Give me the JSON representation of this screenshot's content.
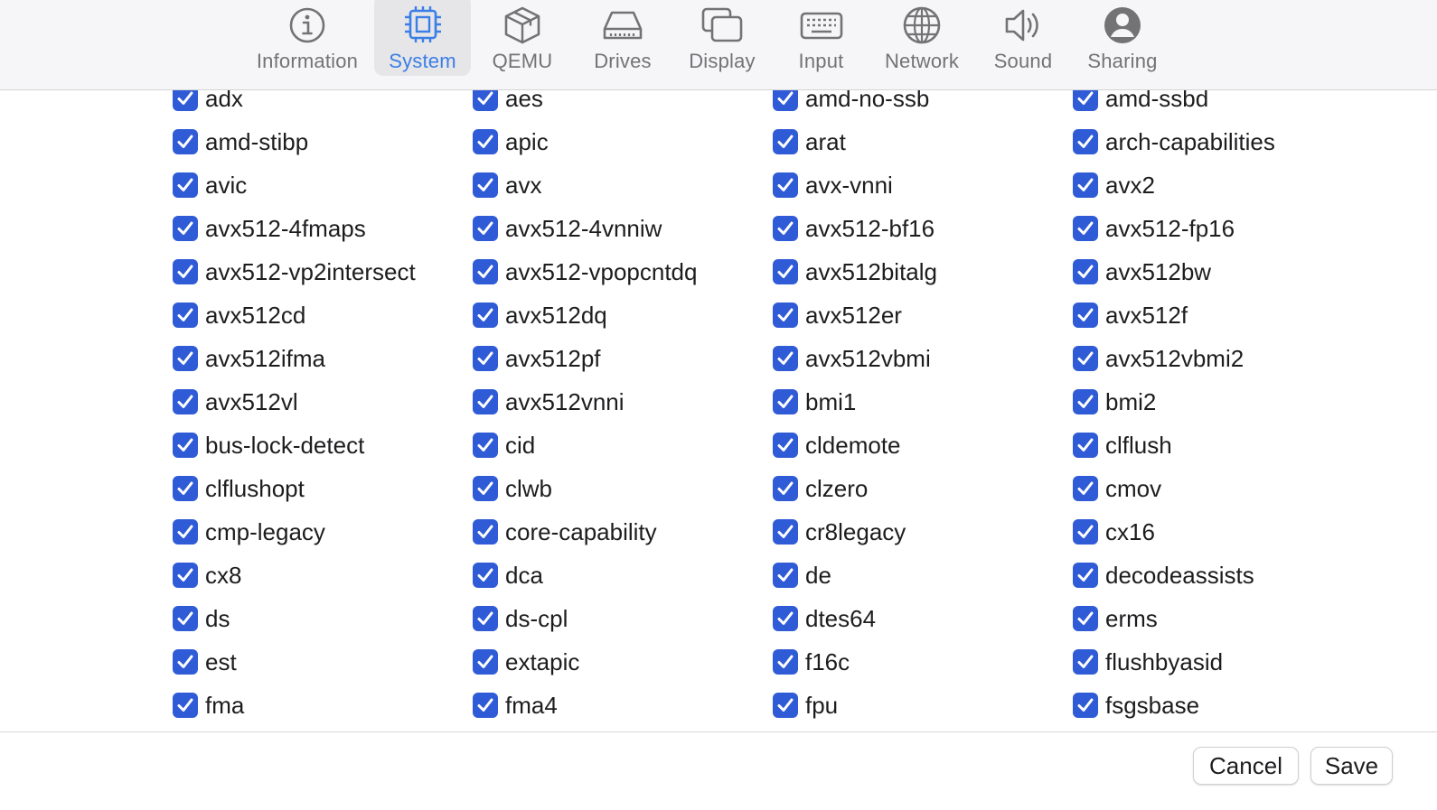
{
  "toolbar": {
    "tabs": [
      {
        "label": "Information",
        "icon": "info-icon",
        "active": false
      },
      {
        "label": "System",
        "icon": "cpu-icon",
        "active": true
      },
      {
        "label": "QEMU",
        "icon": "box-icon",
        "active": false
      },
      {
        "label": "Drives",
        "icon": "drive-icon",
        "active": false
      },
      {
        "label": "Display",
        "icon": "display-icon",
        "active": false
      },
      {
        "label": "Input",
        "icon": "keyboard-icon",
        "active": false
      },
      {
        "label": "Network",
        "icon": "globe-icon",
        "active": false
      },
      {
        "label": "Sound",
        "icon": "speaker-icon",
        "active": false
      },
      {
        "label": "Sharing",
        "icon": "person-icon",
        "active": false
      }
    ],
    "accent_color": "#3a7ee6"
  },
  "features": {
    "checked_color": "#2f5bd6",
    "items": [
      {
        "label": "adx",
        "checked": true
      },
      {
        "label": "aes",
        "checked": true
      },
      {
        "label": "amd-no-ssb",
        "checked": true
      },
      {
        "label": "amd-ssbd",
        "checked": true
      },
      {
        "label": "amd-stibp",
        "checked": true
      },
      {
        "label": "apic",
        "checked": true
      },
      {
        "label": "arat",
        "checked": true
      },
      {
        "label": "arch-capabilities",
        "checked": true
      },
      {
        "label": "avic",
        "checked": true
      },
      {
        "label": "avx",
        "checked": true
      },
      {
        "label": "avx-vnni",
        "checked": true
      },
      {
        "label": "avx2",
        "checked": true
      },
      {
        "label": "avx512-4fmaps",
        "checked": true
      },
      {
        "label": "avx512-4vnniw",
        "checked": true
      },
      {
        "label": "avx512-bf16",
        "checked": true
      },
      {
        "label": "avx512-fp16",
        "checked": true
      },
      {
        "label": "avx512-vp2intersect",
        "checked": true
      },
      {
        "label": "avx512-vpopcntdq",
        "checked": true
      },
      {
        "label": "avx512bitalg",
        "checked": true
      },
      {
        "label": "avx512bw",
        "checked": true
      },
      {
        "label": "avx512cd",
        "checked": true
      },
      {
        "label": "avx512dq",
        "checked": true
      },
      {
        "label": "avx512er",
        "checked": true
      },
      {
        "label": "avx512f",
        "checked": true
      },
      {
        "label": "avx512ifma",
        "checked": true
      },
      {
        "label": "avx512pf",
        "checked": true
      },
      {
        "label": "avx512vbmi",
        "checked": true
      },
      {
        "label": "avx512vbmi2",
        "checked": true
      },
      {
        "label": "avx512vl",
        "checked": true
      },
      {
        "label": "avx512vnni",
        "checked": true
      },
      {
        "label": "bmi1",
        "checked": true
      },
      {
        "label": "bmi2",
        "checked": true
      },
      {
        "label": "bus-lock-detect",
        "checked": true
      },
      {
        "label": "cid",
        "checked": true
      },
      {
        "label": "cldemote",
        "checked": true
      },
      {
        "label": "clflush",
        "checked": true
      },
      {
        "label": "clflushopt",
        "checked": true
      },
      {
        "label": "clwb",
        "checked": true
      },
      {
        "label": "clzero",
        "checked": true
      },
      {
        "label": "cmov",
        "checked": true
      },
      {
        "label": "cmp-legacy",
        "checked": true
      },
      {
        "label": "core-capability",
        "checked": true
      },
      {
        "label": "cr8legacy",
        "checked": true
      },
      {
        "label": "cx16",
        "checked": true
      },
      {
        "label": "cx8",
        "checked": true
      },
      {
        "label": "dca",
        "checked": true
      },
      {
        "label": "de",
        "checked": true
      },
      {
        "label": "decodeassists",
        "checked": true
      },
      {
        "label": "ds",
        "checked": true
      },
      {
        "label": "ds-cpl",
        "checked": true
      },
      {
        "label": "dtes64",
        "checked": true
      },
      {
        "label": "erms",
        "checked": true
      },
      {
        "label": "est",
        "checked": true
      },
      {
        "label": "extapic",
        "checked": true
      },
      {
        "label": "f16c",
        "checked": true
      },
      {
        "label": "flushbyasid",
        "checked": true
      },
      {
        "label": "fma",
        "checked": true
      },
      {
        "label": "fma4",
        "checked": true
      },
      {
        "label": "fpu",
        "checked": true
      },
      {
        "label": "fsgsbase",
        "checked": true
      }
    ]
  },
  "footer": {
    "cancel_label": "Cancel",
    "save_label": "Save"
  }
}
